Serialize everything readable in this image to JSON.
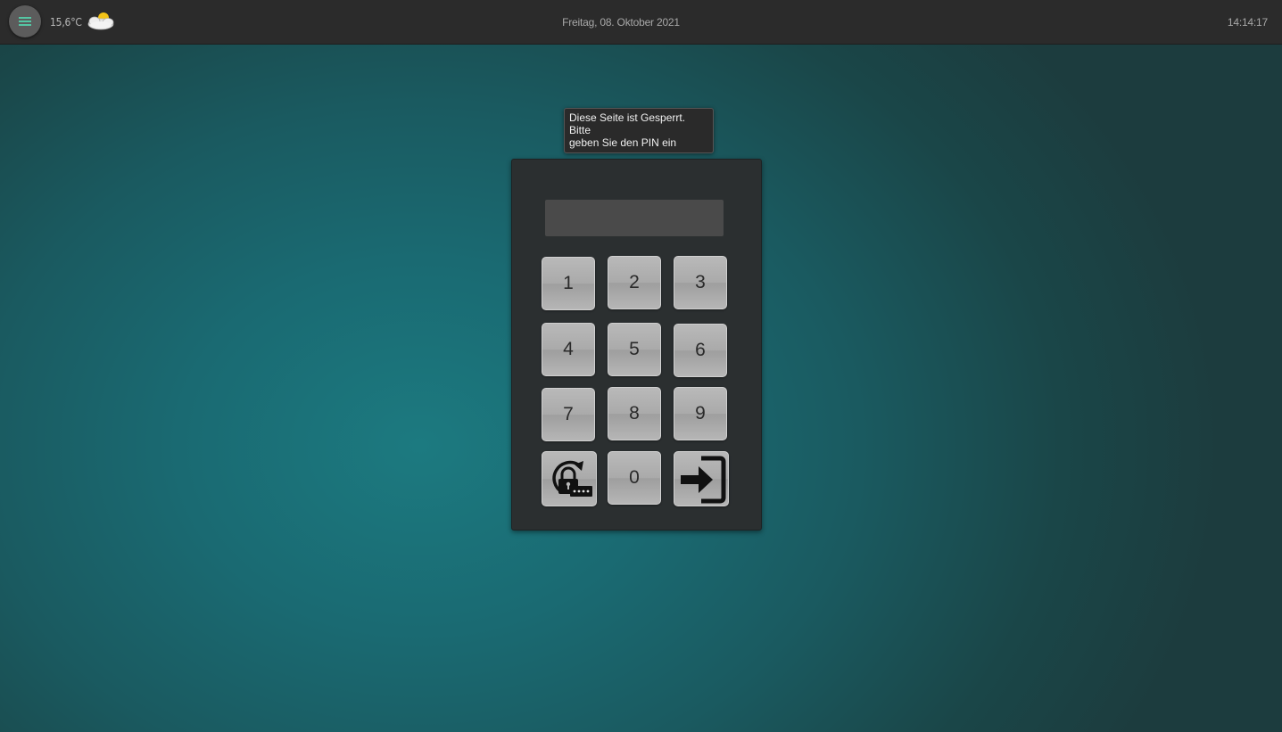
{
  "header": {
    "menu_icon": "hamburger-menu-icon",
    "temperature": "15,6°C",
    "weather_icon": "partly-cloudy-icon",
    "date": "Freitag, 08. Oktober 2021",
    "time": "14:14:17"
  },
  "lock": {
    "tooltip_line1": "Diese Seite ist Gesperrt. Bitte",
    "tooltip_line2": "geben Sie den PIN ein",
    "pin_value": "",
    "keys": {
      "k1": "1",
      "k2": "2",
      "k3": "3",
      "k4": "4",
      "k5": "5",
      "k6": "6",
      "k7": "7",
      "k8": "8",
      "k9": "9",
      "k0": "0"
    },
    "reset_icon": "lock-reset-pin-icon",
    "enter_icon": "login-enter-icon"
  },
  "colors": {
    "topbar": "#2b2b2b",
    "background": "#1c7a80",
    "key": "#aaaaaa",
    "panel": "#2b2f30"
  }
}
